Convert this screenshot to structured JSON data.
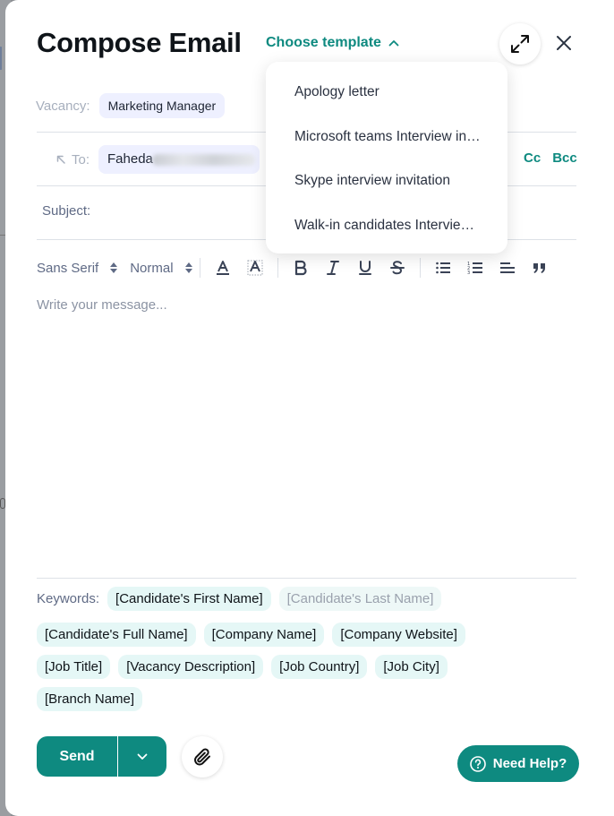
{
  "header": {
    "title": "Compose Email",
    "choose_template_label": "Choose template"
  },
  "template_menu": {
    "items": [
      "Apology letter",
      "Microsoft teams Interview invitation",
      "Skype interview invitation",
      "Walk-in candidates Interview invitation"
    ]
  },
  "vacancy": {
    "label": "Vacancy:",
    "value": "Marketing Manager"
  },
  "recipients": {
    "to_label": "To:",
    "to_value": "Faheda",
    "cc_label": "Cc",
    "bcc_label": "Bcc"
  },
  "subject": {
    "label": "Subject:"
  },
  "toolbar": {
    "font_family": "Sans Serif",
    "font_size": "Normal"
  },
  "editor": {
    "placeholder": "Write your message..."
  },
  "keywords": {
    "label": "Keywords:",
    "items": [
      "[Candidate's First Name]",
      "[Candidate's Last Name]",
      "[Candidate's Full Name]",
      "[Company Name]",
      "[Company Website]",
      "[Job Title]",
      "[Vacancy Description]",
      "[Job Country]",
      "[Job City]",
      "[Branch Name]"
    ]
  },
  "actions": {
    "send_label": "Send",
    "help_label": "Need Help?"
  },
  "colors": {
    "accent": "#0e8a80",
    "chip_blue": "#eef0ff",
    "chip_teal": "#e5f7f6"
  }
}
